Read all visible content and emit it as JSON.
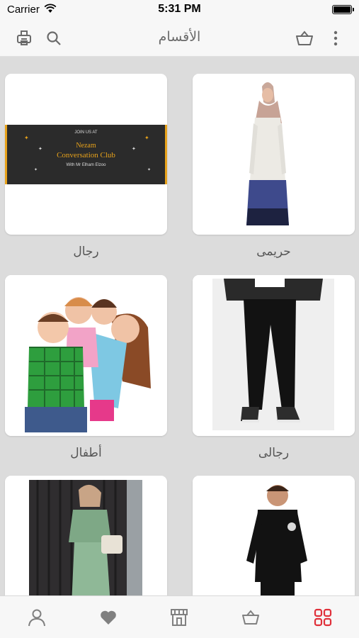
{
  "status_bar": {
    "carrier": "Carrier",
    "time": "5:31 PM",
    "battery_level": 1.0
  },
  "navbar": {
    "title": "الأقسام",
    "icons": [
      "printer-icon",
      "search-icon",
      "basket-icon",
      "more-vertical-icon"
    ]
  },
  "categories": [
    {
      "label": "حريمى",
      "image": "woman-abaya-photo"
    },
    {
      "label": "رجال",
      "image": "conversation-club-banner",
      "banner": {
        "top": "JOIN US AT",
        "line1": "Nezam",
        "line2": "Conversation Club",
        "sub": "With Mr Elham Elzoo"
      }
    },
    {
      "label": "رجالى",
      "image": "man-black-jeans-photo"
    },
    {
      "label": "أطفال",
      "image": "happy-kids-photo"
    },
    {
      "label": "",
      "image": "boy-black-suit-photo"
    },
    {
      "label": "",
      "image": "woman-green-dress-photo"
    }
  ],
  "tabbar": {
    "tabs": [
      "profile-icon",
      "favorites-heart-icon",
      "store-icon",
      "basket-icon",
      "categories-grid-icon"
    ],
    "active_index": 4,
    "active_color": "#e0303a",
    "inactive_color": "#808080"
  },
  "colors": {
    "background": "#dcdcdc",
    "bar": "#f7f7f7",
    "banner_gold": "#e7a21b",
    "banner_dark": "#2b2b2b"
  }
}
